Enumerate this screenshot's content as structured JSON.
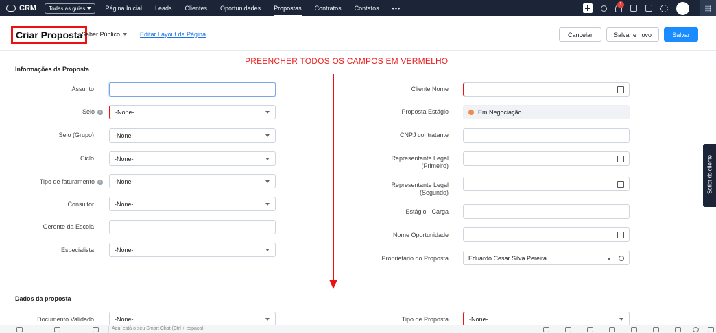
{
  "topbar": {
    "brand": "CRM",
    "guides": "Todas as guias",
    "nav": [
      "Página Inicial",
      "Leads",
      "Clientes",
      "Oportunidades",
      "Propostas",
      "Contratos",
      "Contatos",
      "•••"
    ],
    "active": "Propostas",
    "notification_count": "1"
  },
  "header": {
    "title": "Criar Proposta",
    "layout": "Saber Público",
    "edit_layout": "Editar Layout da Página",
    "cancel": "Cancelar",
    "save_new": "Salvar e novo",
    "save": "Salvar"
  },
  "instruction": "PREENCHER TODOS OS CAMPOS EM VERMELHO",
  "sections": {
    "info": "Informações da Proposta",
    "dados": "Dados da proposta"
  },
  "left_fields": [
    {
      "label": "Assunto",
      "value": ""
    },
    {
      "label": "Selo",
      "value": "-None-"
    },
    {
      "label": "Selo (Grupo)",
      "value": "-None-"
    },
    {
      "label": "Ciclo",
      "value": "-None-"
    },
    {
      "label": "Tipo de faturamento",
      "value": "-None-"
    },
    {
      "label": "Consultor",
      "value": "-None-"
    },
    {
      "label": "Gerente da Escola",
      "value": ""
    },
    {
      "label": "Especialista",
      "value": "-None-"
    }
  ],
  "right_fields": [
    {
      "label": "Cliente Nome",
      "value": ""
    },
    {
      "label": "Proposta Estágio",
      "value": "Em Negociação"
    },
    {
      "label": "CNPJ contratante",
      "value": ""
    },
    {
      "label_1": "Representante Legal",
      "label_2": "(Primeiro)",
      "value": ""
    },
    {
      "label_1": "Representante Legal",
      "label_2": "(Segundo)",
      "value": ""
    },
    {
      "label": "Estágio - Carga",
      "value": ""
    },
    {
      "label": "Nome Oportunidade",
      "value": ""
    },
    {
      "label": "Proprietário do Proposta",
      "value": "Eduardo Cesar Silva Pereira"
    }
  ],
  "dados_fields": {
    "left": {
      "label": "Documento Validado",
      "value": "-None-"
    },
    "right": {
      "label": "Tipo de Proposta",
      "value": "-None-"
    }
  },
  "side_tab": "Script do cliente",
  "bottom": {
    "smart_chat": "Aqui está o seu Smart Chat (Ctrl + espaço)"
  }
}
